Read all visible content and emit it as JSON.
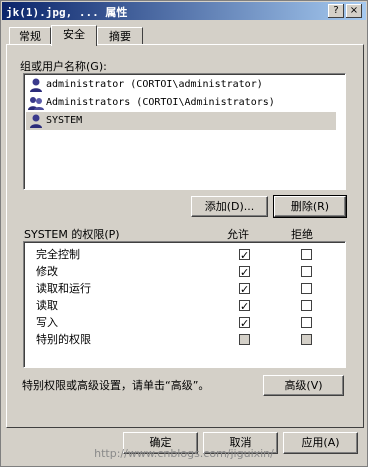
{
  "window": {
    "title": "jk(1).jpg, ... 属性",
    "help_glyph": "?",
    "close_glyph": "×"
  },
  "tabs": [
    {
      "label": "常规"
    },
    {
      "label": "安全"
    },
    {
      "label": "摘要"
    }
  ],
  "users_label": "组或用户名称(G):",
  "users": [
    {
      "name": "administrator (CORTOI\\administrator)",
      "icon": "user-icon"
    },
    {
      "name": "Administrators (CORTOI\\Administrators)",
      "icon": "group-icon"
    },
    {
      "name": "SYSTEM",
      "icon": "user-icon"
    }
  ],
  "selected_user": "SYSTEM",
  "buttons": {
    "add": "添加(D)...",
    "remove": "删除(R)",
    "advanced": "高级(V)",
    "ok": "确定",
    "cancel": "取消",
    "apply": "应用(A)"
  },
  "perm_header": {
    "label": "SYSTEM 的权限(P)",
    "allow": "允许",
    "deny": "拒绝"
  },
  "permissions": [
    {
      "name": "完全控制",
      "allow": true,
      "deny": false,
      "disabled": false
    },
    {
      "name": "修改",
      "allow": true,
      "deny": false,
      "disabled": false
    },
    {
      "name": "读取和运行",
      "allow": true,
      "deny": false,
      "disabled": false
    },
    {
      "name": "读取",
      "allow": true,
      "deny": false,
      "disabled": false
    },
    {
      "name": "写入",
      "allow": true,
      "deny": false,
      "disabled": false
    },
    {
      "name": "特别的权限",
      "allow": false,
      "deny": false,
      "disabled": true
    }
  ],
  "advanced_note": "特别权限或高级设置，请单击“高级”。",
  "watermark": "http://www.cnblogs.com/jiguixin/"
}
